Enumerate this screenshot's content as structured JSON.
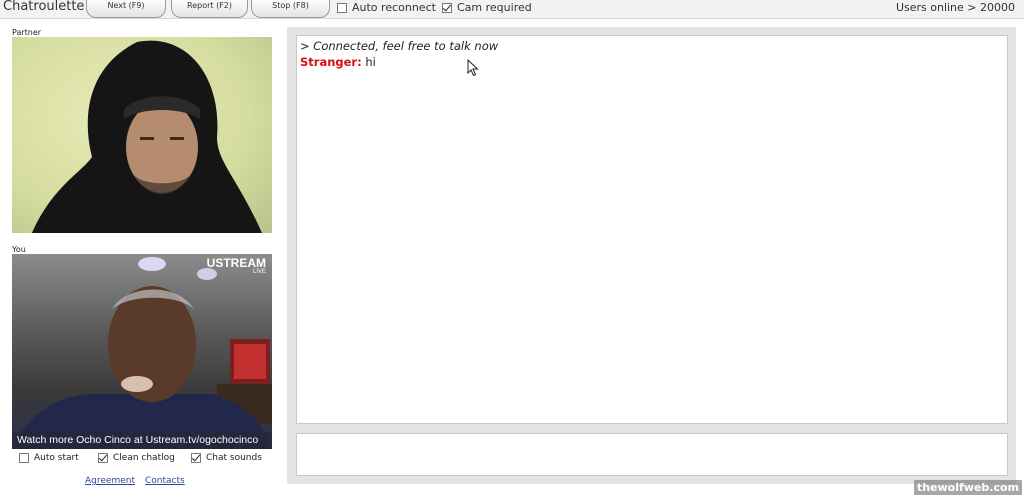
{
  "app": {
    "title": "Chatroulette"
  },
  "toolbar": {
    "next_label": "Next (F9)",
    "report_label": "Report (F2)",
    "stop_label": "Stop (F8)",
    "auto_reconnect": {
      "label": "Auto reconnect",
      "checked": false
    },
    "cam_required": {
      "label": "Cam required",
      "checked": true
    },
    "users_online": "Users online > 20000"
  },
  "partner": {
    "label": "Partner"
  },
  "you": {
    "label": "You",
    "logo_main": "USTREAM",
    "logo_sub": "LIVE",
    "caption": "Watch more Ocho Cinco at Ustream.tv/ogochocinco"
  },
  "options": {
    "auto_start": {
      "label": "Auto start",
      "checked": false
    },
    "clean_chatlog": {
      "label": "Clean chatlog",
      "checked": true
    },
    "chat_sounds": {
      "label": "Chat sounds",
      "checked": true
    }
  },
  "links": {
    "agreement": "Agreement",
    "contacts": "Contacts"
  },
  "chat": {
    "system_message": "> Connected, feel free to talk now",
    "messages": [
      {
        "sender": "Stranger:",
        "text": "hi"
      }
    ],
    "input_value": ""
  },
  "watermark": "thewolfweb.com",
  "colors": {
    "stranger": "#d51010",
    "panel_bg": "#e4e4e4",
    "link": "#2a4a9a"
  }
}
